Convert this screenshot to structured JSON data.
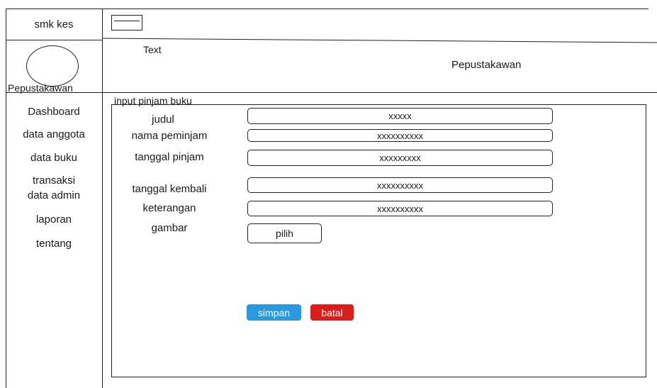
{
  "brand": {
    "name": "smk kes"
  },
  "header": {
    "text": "Text",
    "role": "Pepustakawan"
  },
  "profile": {
    "label": "Pepustakawan"
  },
  "sidebar": {
    "items": [
      {
        "label": "Dashboard"
      },
      {
        "label": "data anggota"
      },
      {
        "label": "data buku"
      },
      {
        "label": "transaksi"
      },
      {
        "label": "data admin"
      },
      {
        "label": "laporan"
      },
      {
        "label": "tentang"
      }
    ]
  },
  "form": {
    "title": "input pinjam buku",
    "fields": [
      {
        "label": "judul",
        "value": "xxxxx"
      },
      {
        "label": "nama peminjam",
        "value": "xxxxxxxxxx"
      },
      {
        "label": "tanggal pinjam",
        "value": "xxxxxxxxx"
      },
      {
        "label": "tanggal kembali",
        "value": "xxxxxxxxxx"
      },
      {
        "label": "keterangan",
        "value": "xxxxxxxxxx"
      }
    ],
    "image": {
      "label": "gambar",
      "button": "pilih"
    },
    "save_label": "simpan",
    "cancel_label": "batal"
  },
  "colors": {
    "save": "#2a9ae0",
    "cancel": "#dd1c1c"
  }
}
